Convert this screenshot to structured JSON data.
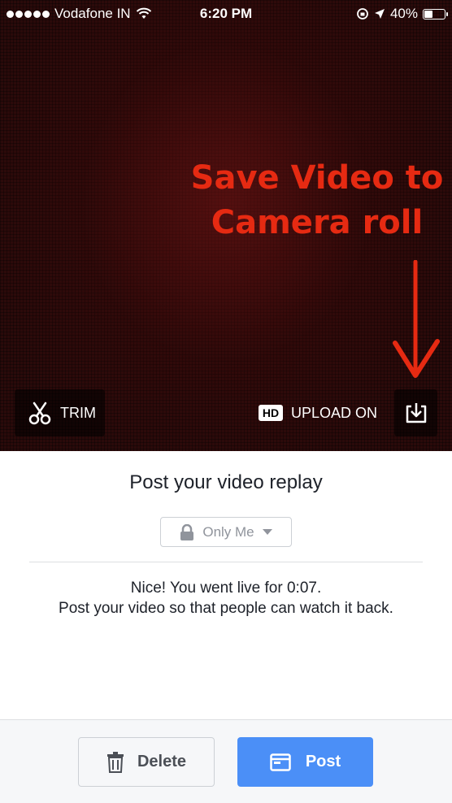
{
  "status_bar": {
    "carrier": "Vodafone IN",
    "time": "6:20 PM",
    "battery": "40%",
    "battery_level": 0.4
  },
  "video": {
    "annotation_line1": "Save Video to",
    "annotation_line2": "Camera roll",
    "annotation_color": "#e62a12",
    "trim_label": "TRIM",
    "hd_badge": "HD",
    "upload_label": "UPLOAD ON",
    "icons": [
      "scissors-icon",
      "download-icon",
      "arrow-down-icon"
    ]
  },
  "panel": {
    "title": "Post your video replay",
    "privacy_value": "Only Me",
    "message_line1": "Nice! You went live for 0:07.",
    "message_line2": "Post your video so that people can watch it back."
  },
  "footer": {
    "delete_label": "Delete",
    "post_label": "Post",
    "post_color": "#4b8ff7"
  }
}
